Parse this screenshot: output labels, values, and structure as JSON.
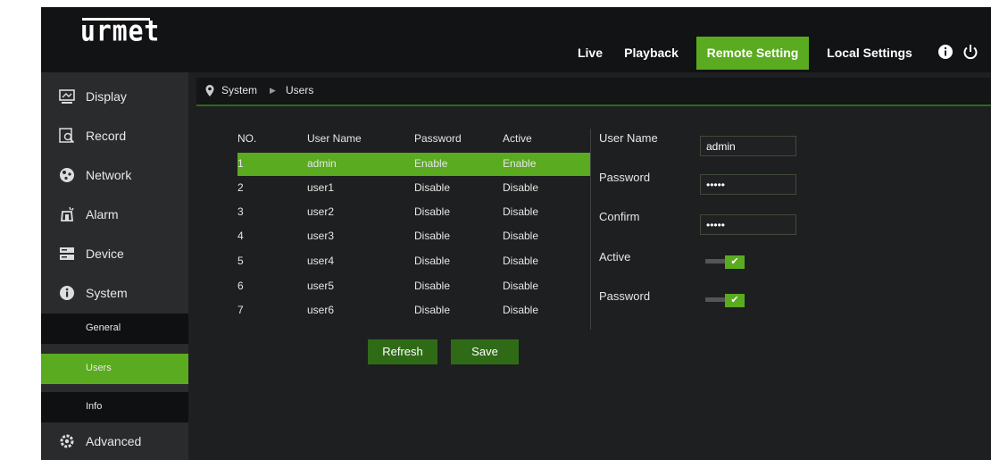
{
  "brand": {
    "logo_text": "urmet"
  },
  "nav": {
    "live": "Live",
    "playback": "Playback",
    "remote_setting": "Remote Setting",
    "local_settings": "Local Settings"
  },
  "icons": {
    "info": "info-icon",
    "power": "power-icon"
  },
  "sidebar": {
    "items": [
      {
        "label": "Display",
        "icon": "display-icon"
      },
      {
        "label": "Record",
        "icon": "record-icon"
      },
      {
        "label": "Network",
        "icon": "network-icon"
      },
      {
        "label": "Alarm",
        "icon": "alarm-icon"
      },
      {
        "label": "Device",
        "icon": "device-icon"
      },
      {
        "label": "System",
        "icon": "system-info-icon"
      },
      {
        "label": "Advanced",
        "icon": "gear-icon"
      }
    ],
    "system_sub": [
      {
        "label": "General",
        "active": false
      },
      {
        "label": "Users",
        "active": true
      },
      {
        "label": "Info",
        "active": false
      }
    ]
  },
  "breadcrumb": {
    "system": "System",
    "users": "Users"
  },
  "table": {
    "headers": [
      "NO.",
      "User Name",
      "Password",
      "Active"
    ],
    "rows": [
      [
        "1",
        "admin",
        "Enable",
        "Enable"
      ],
      [
        "2",
        "user1",
        "Disable",
        "Disable"
      ],
      [
        "3",
        "user2",
        "Disable",
        "Disable"
      ],
      [
        "4",
        "user3",
        "Disable",
        "Disable"
      ],
      [
        "5",
        "user4",
        "Disable",
        "Disable"
      ],
      [
        "6",
        "user5",
        "Disable",
        "Disable"
      ],
      [
        "7",
        "user6",
        "Disable",
        "Disable"
      ]
    ],
    "selected_row": 0
  },
  "form": {
    "user_name_label": "User Name",
    "user_name_value": "admin",
    "password_label": "Password",
    "password_value": "•••••",
    "confirm_label": "Confirm",
    "confirm_value": "•••••",
    "active_label": "Active",
    "active_checked": true,
    "password_toggle_label": "Password",
    "password_toggle_checked": true
  },
  "buttons": {
    "refresh": "Refresh",
    "save": "Save"
  },
  "colors": {
    "accent": "#5aab1f",
    "button": "#2f6b17",
    "background": "#1e1f20",
    "topbar": "#121314"
  }
}
